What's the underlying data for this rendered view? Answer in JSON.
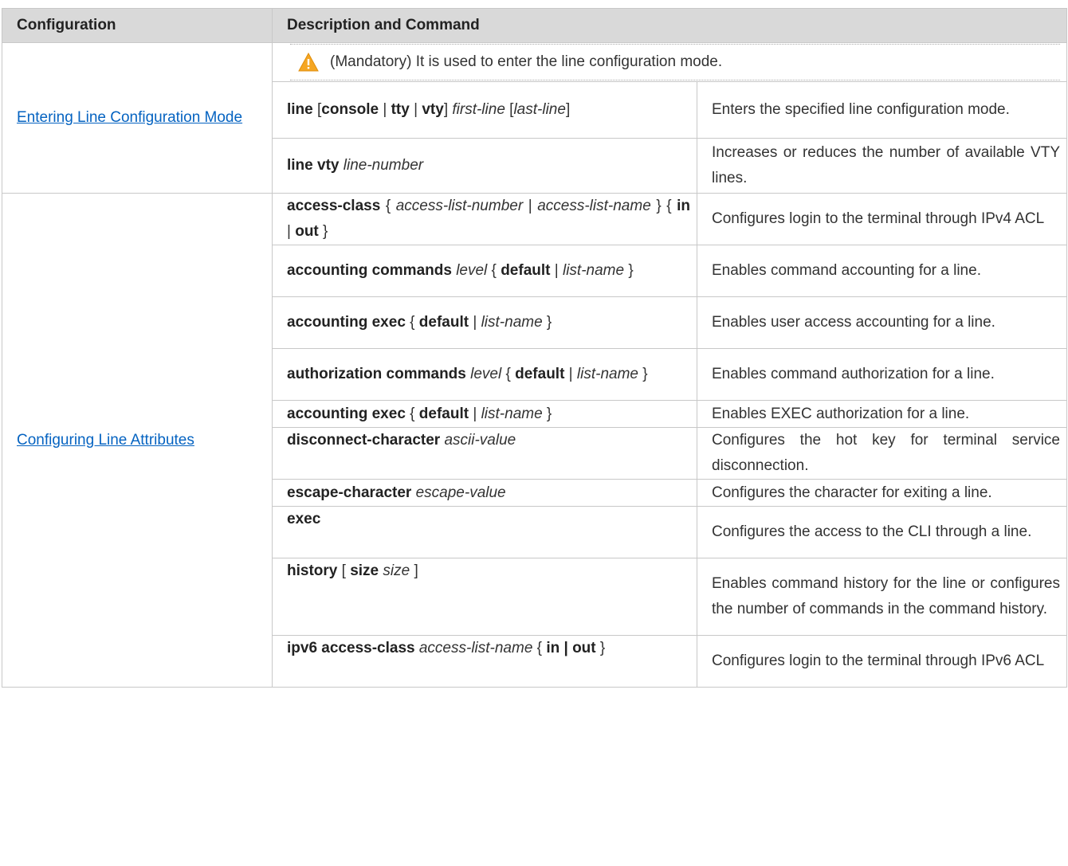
{
  "header": {
    "col1": "Configuration",
    "col2": "Description and Command"
  },
  "sections": [
    {
      "link": "Entering Line Configuration Mode",
      "note": "(Mandatory) It is used to enter the line configuration mode.",
      "rows": [
        {
          "desc": "Enters the specified line configuration mode."
        },
        {
          "desc": "Increases or reduces the number of available VTY lines."
        }
      ]
    },
    {
      "link": "Configuring Line Attributes",
      "rows": [
        {
          "desc": "Configures login to the terminal through IPv4 ACL"
        },
        {
          "desc": "Enables command accounting for a line."
        },
        {
          "desc": "Enables user access accounting for a line."
        },
        {
          "desc": "Enables command authorization for a line."
        },
        {
          "desc": "Enables EXEC authorization for a line."
        },
        {
          "desc": "Configures the hot key for terminal service disconnection."
        },
        {
          "desc": "Configures the character for exiting a line."
        },
        {
          "desc": "Configures the access to the CLI through a line."
        },
        {
          "desc": "Enables command history for the line or configures the number of commands in the command history."
        },
        {
          "desc": "Configures login to the terminal through IPv6 ACL"
        }
      ]
    }
  ],
  "commands": {
    "line": {
      "kw1": "line",
      "o1": " [",
      "kw2": "console",
      "s1": " | ",
      "kw3": "tty",
      "s2": " | ",
      "kw4": "vty",
      "s3": "] ",
      "a1": "first-line",
      "s4": " [",
      "a2": "last-line",
      "s5": "]"
    },
    "line_vty": {
      "kw1": "line vty",
      "s1": " ",
      "a1": "line-number"
    },
    "access_class": {
      "kw1": "access-class",
      "s1": " { ",
      "a1": "access-list-number",
      "s2": " | ",
      "a2": "access-list-name",
      "s3": " } { ",
      "kw2": "in",
      "s4": " | ",
      "kw3": "out",
      "s5": " }"
    },
    "acct_cmd": {
      "kw1": "accounting commands",
      "s1": " ",
      "a1": "level",
      "s2": " { ",
      "kw2": "default",
      "s3": " | ",
      "a2": "list-name",
      "s4": " }"
    },
    "acct_exec": {
      "kw1": "accounting exec",
      "s1": " { ",
      "kw2": "default",
      "s2": " | ",
      "a1": "list-name",
      "s3": " }"
    },
    "auth_cmd": {
      "kw1": "authorization commands",
      "s1": " ",
      "a1": "level",
      "s2": " { ",
      "kw2": "default",
      "s3": " | ",
      "a2": "list-name",
      "s4": " }"
    },
    "acct_exec2": {
      "kw1": "accounting exec",
      "s1": " { ",
      "kw2": "default",
      "s2": " | ",
      "a1": "list-name",
      "s3": " }"
    },
    "disconnect": {
      "kw1": "disconnect-character",
      "s1": " ",
      "a1": "ascii-value"
    },
    "escape": {
      "kw1": "escape-character",
      "s1": " ",
      "a1": "escape-value"
    },
    "exec": {
      "kw1": "exec"
    },
    "history": {
      "kw1": "history",
      "s1": " [ ",
      "kw2": "size",
      "s2": " ",
      "a1": "size",
      "s3": " ]"
    },
    "ipv6": {
      "kw1": "ipv6 access-class",
      "s1": " ",
      "a1": "access-list-name",
      "s2": " { ",
      "kw2": "in | out",
      "s3": " }"
    }
  },
  "colors": {
    "header_bg": "#d9d9d9",
    "link": "#0563c1",
    "border": "#c8c8c8",
    "warning": "#f5a623"
  },
  "icons": {
    "note": "warning-icon"
  }
}
